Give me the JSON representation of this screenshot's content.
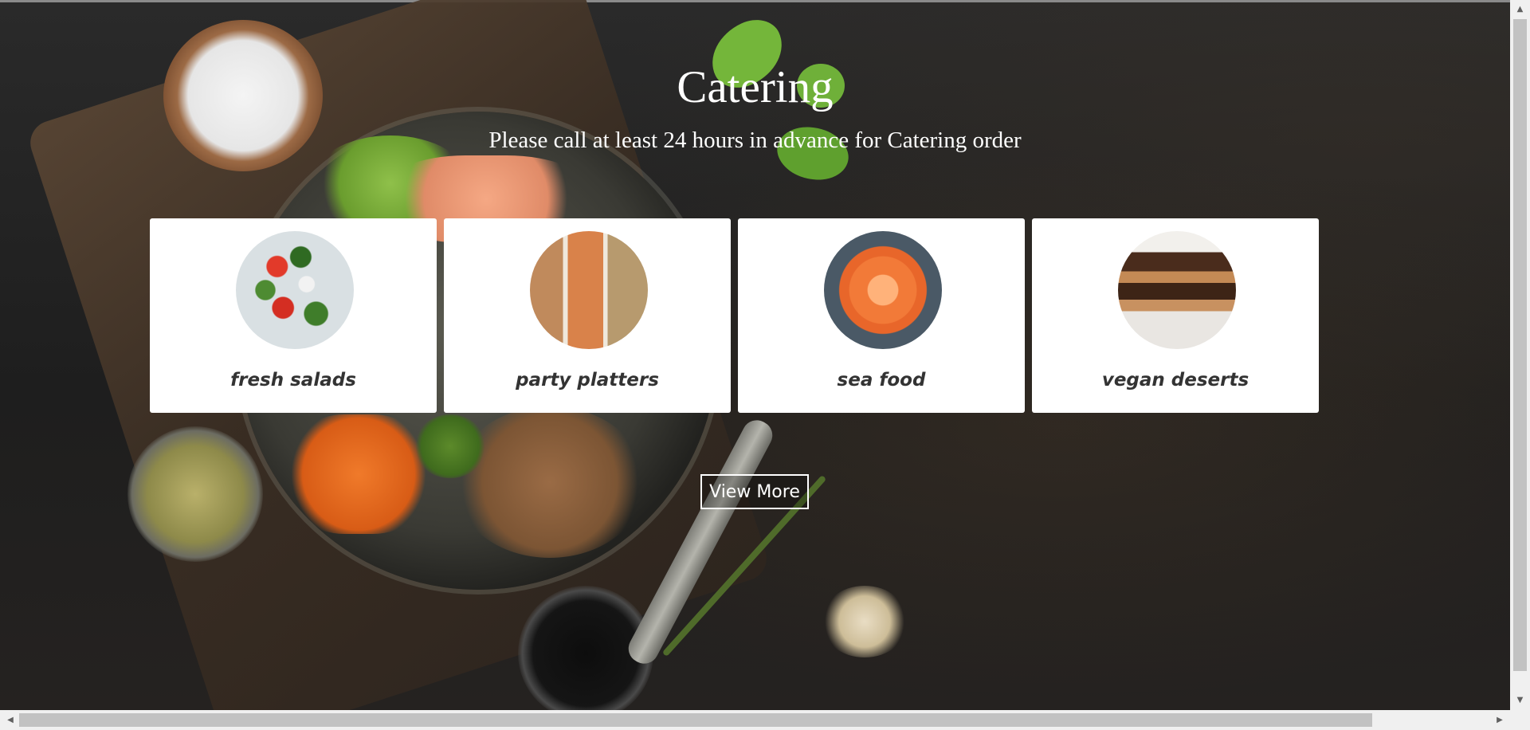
{
  "hero": {
    "title": "Catering",
    "subtitle": "Please call at least 24 hours in advance for Catering order"
  },
  "cards": [
    {
      "label": "fresh salads",
      "image": "salad-photo"
    },
    {
      "label": "party platters",
      "image": "platter-photo"
    },
    {
      "label": "sea food",
      "image": "shrimp-photo"
    },
    {
      "label": "vegan deserts",
      "image": "brownie-photo"
    }
  ],
  "cta": {
    "label": "View More"
  },
  "scrollbars": {
    "up_arrow": "▲",
    "down_arrow": "▼",
    "left_arrow": "◀",
    "right_arrow": "▶"
  },
  "colors": {
    "card_background": "#ffffff",
    "card_text": "#333333",
    "hero_text": "#ffffff"
  }
}
